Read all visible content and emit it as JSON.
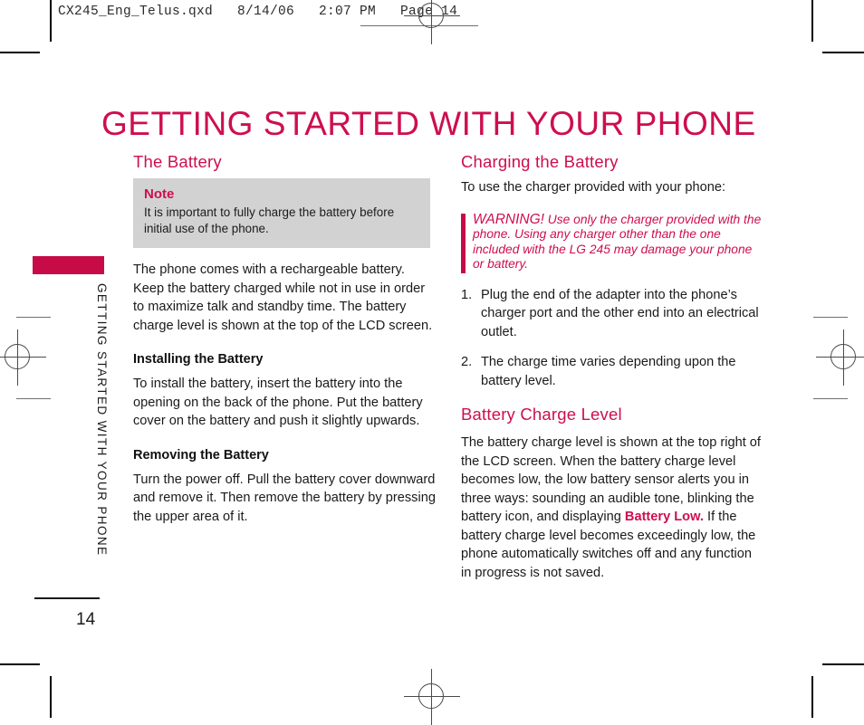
{
  "proof": {
    "header_line": "CX245_Eng_Telus.qxd   8/14/06   2:07 PM   Page 14"
  },
  "page": {
    "title": "GETTING STARTED WITH YOUR PHONE",
    "number": "14",
    "side_label": "GETTING STARTED WITH YOUR PHONE",
    "accent_color": "#CE0E4F",
    "tab_color": "#C60B47",
    "note_bg": "#D2D2D2"
  },
  "left_column": {
    "section_title": "The Battery",
    "note": {
      "title": "Note",
      "text": "It is important to fully charge the battery before initial use of the phone."
    },
    "intro_paragraph": "The phone comes with a rechargeable battery. Keep the battery charged while not in use in order to maximize talk and standby time. The battery charge level is shown at the top of the LCD screen.",
    "installing": {
      "heading": "Installing the Battery",
      "text": "To install the battery, insert the battery into the opening on the back of the phone. Put the battery cover on the battery and push it slightly upwards."
    },
    "removing": {
      "heading": "Removing the Battery",
      "text": "Turn the power off. Pull the battery cover downward and remove it. Then remove the battery by pressing the upper area of it."
    }
  },
  "right_column": {
    "charging": {
      "section_title": "Charging the Battery",
      "intro": "To use the charger provided with your phone:",
      "warning": {
        "lead": "WARNING!",
        "text": "Use only the charger provided with the phone. Using any charger other than the one included with the LG 245 may damage your phone or battery."
      },
      "steps": [
        {
          "marker": "1.",
          "text": "Plug the end of the adapter into the phone’s charger port and the other end into an electrical outlet."
        },
        {
          "marker": "2.",
          "text": "The charge time varies depending upon the battery level."
        }
      ]
    },
    "charge_level": {
      "section_title": "Battery Charge Level",
      "text_before": "The battery charge level is shown at the top right of the LCD screen. When the battery charge level becomes low, the low battery sensor alerts you in three ways: sounding an audible tone, blinking the battery icon, and displaying ",
      "highlight": "Battery Low.",
      "text_after": " If the battery charge level becomes exceedingly low, the phone automatically switches off and any function in progress is not saved."
    }
  }
}
